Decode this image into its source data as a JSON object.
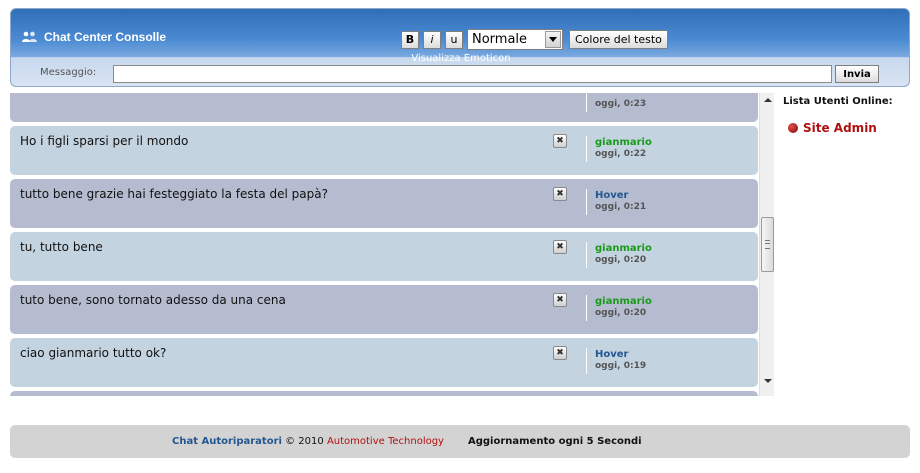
{
  "header": {
    "title": "Chat Center Consolle",
    "bold_label": "B",
    "italic_label": "i",
    "underline_label": "u",
    "size_select_value": "Normale",
    "color_button": "Colore del testo",
    "emoticon_link": "Visualizza Emoticon",
    "message_label": "Messaggio:",
    "message_value": "",
    "send_button": "Invia"
  },
  "messages": [
    {
      "text": "",
      "author": "",
      "time": "oggi, 0:23",
      "style": "dark",
      "author_color": "green"
    },
    {
      "text": "Ho i figli sparsi per il mondo",
      "author": "gianmario",
      "time": "oggi, 0:22",
      "style": "light",
      "author_color": "green"
    },
    {
      "text": "tutto bene grazie hai festeggiato la festa del papà?",
      "author": "Hover",
      "time": "oggi, 0:21",
      "style": "dark",
      "author_color": "blue"
    },
    {
      "text": "tu, tutto bene",
      "author": "gianmario",
      "time": "oggi, 0:20",
      "style": "light",
      "author_color": "green"
    },
    {
      "text": "tuto bene, sono tornato adesso da una cena",
      "author": "gianmario",
      "time": "oggi, 0:20",
      "style": "dark",
      "author_color": "green"
    },
    {
      "text": "ciao gianmario tutto ok?",
      "author": "Hover",
      "time": "oggi, 0:19",
      "style": "light",
      "author_color": "blue"
    },
    {
      "text": "",
      "author": "",
      "time": "",
      "style": "dark",
      "author_color": "green"
    }
  ],
  "online": {
    "title": "Lista Utenti Online:",
    "users": [
      "Site Admin"
    ]
  },
  "footer": {
    "brand": "Chat Autoriparatori",
    "copyright": " © 2010 ",
    "company": "Automotive Technology",
    "refresh": "Aggiornamento ogni 5 Secondi"
  },
  "colors": {
    "header_blue": "#2f6fb8",
    "row_light": "#c3d3e0",
    "row_dark": "#b5bccf",
    "author_green": "#1a9a1a",
    "author_blue": "#24568f",
    "admin_red": "#b01010"
  },
  "icons": {
    "app": "users-icon",
    "delete": "delete-message-icon",
    "online_status": "online-status-icon"
  }
}
